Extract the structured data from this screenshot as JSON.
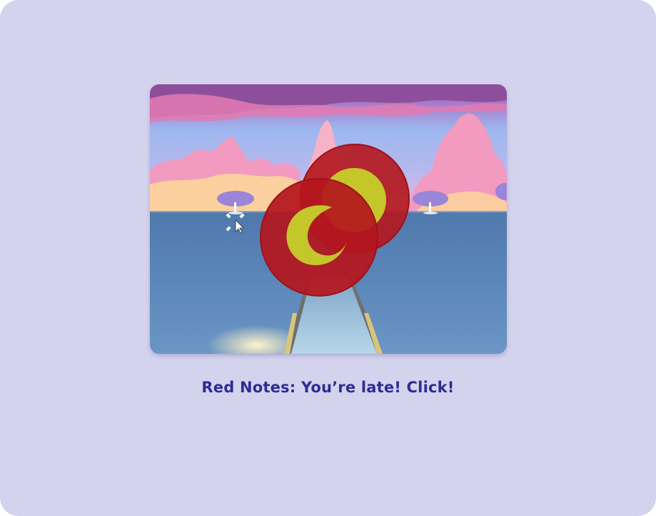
{
  "caption": "Red Notes: You’re late! Click!",
  "scene": {
    "sky_top_color": "#8f6ab8",
    "sky_mid_color": "#9fb6ef",
    "cloud_color": "#f29ac0",
    "cloud_glow_color": "#fdd59a",
    "sea_color": "#5b86b8",
    "tree_color": "#9b85d8",
    "track_color": "#a7c4dd",
    "rail_color": "#d9c47a"
  },
  "notes": [
    {
      "name": "red-note-back",
      "fill": "#b4161d",
      "inner": "#c4c62a"
    },
    {
      "name": "red-note-front",
      "fill": "#b4161d",
      "inner": "#c4c62a"
    }
  ],
  "cursor": {
    "icon": "crosshair-cursor-icon"
  },
  "colors": {
    "background": "#d4d3ee",
    "caption_text": "#2e2c93"
  }
}
